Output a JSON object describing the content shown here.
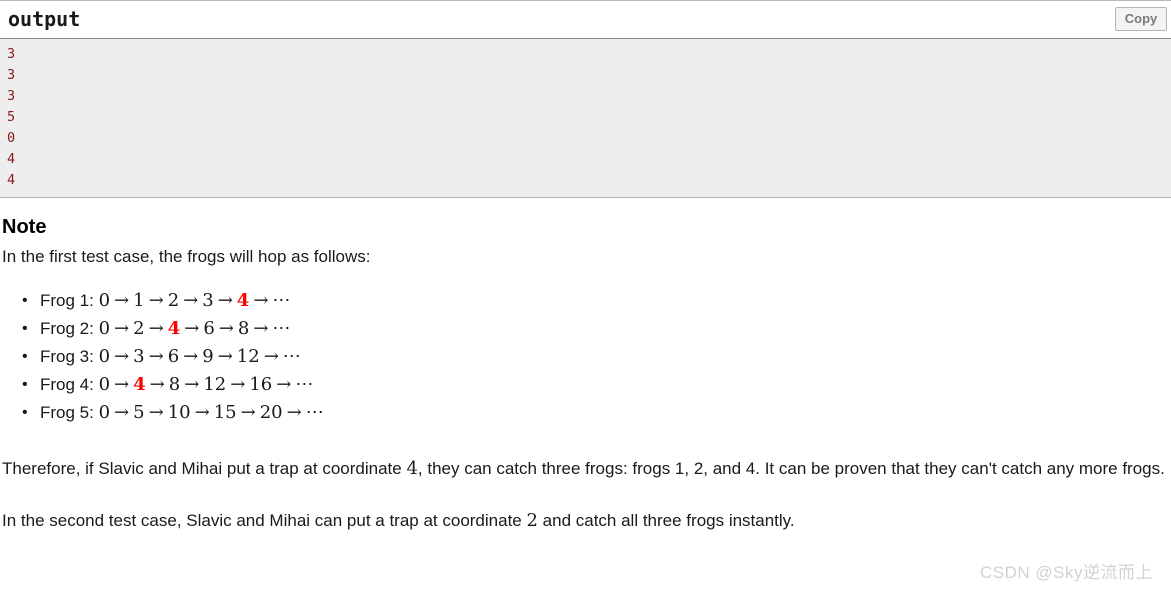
{
  "output_panel": {
    "title": "output",
    "copy_label": "Copy",
    "lines": [
      "3",
      "3",
      "3",
      "5",
      "0",
      "4",
      "4"
    ],
    "text_color": "#8b1a1a",
    "body_background": "#eeeeee",
    "header_background": "#ffffff"
  },
  "note": {
    "heading": "Note",
    "intro": "In the first test case, the frogs will hop as follows:",
    "highlight_color": "#ff0000",
    "frogs": [
      {
        "label": "Frog 1:",
        "steps": [
          "0",
          "1",
          "2",
          "3",
          "4"
        ],
        "highlight_index": 4,
        "trailing": "⋯"
      },
      {
        "label": "Frog 2:",
        "steps": [
          "0",
          "2",
          "4",
          "6",
          "8"
        ],
        "highlight_index": 2,
        "trailing": "⋯"
      },
      {
        "label": "Frog 3:",
        "steps": [
          "0",
          "3",
          "6",
          "9",
          "12"
        ],
        "highlight_index": -1,
        "trailing": "⋯"
      },
      {
        "label": "Frog 4:",
        "steps": [
          "0",
          "4",
          "8",
          "12",
          "16"
        ],
        "highlight_index": 1,
        "trailing": "⋯"
      },
      {
        "label": "Frog 5:",
        "steps": [
          "0",
          "5",
          "10",
          "15",
          "20"
        ],
        "highlight_index": -1,
        "trailing": "⋯"
      }
    ],
    "arrow": "→",
    "paragraph_1": {
      "pre": "Therefore, if Slavic and Mihai put a trap at coordinate ",
      "num": "4",
      "post": ", they can catch three frogs: frogs 1, 2, and 4. It can be proven that they can't catch any more frogs."
    },
    "paragraph_2": {
      "pre": "In the second test case, Slavic and Mihai can put a trap at coordinate ",
      "num": "2",
      "post": " and catch all three frogs instantly."
    }
  },
  "watermark": {
    "text": "CSDN @Sky逆流而上",
    "color": "#d2d2d2"
  }
}
